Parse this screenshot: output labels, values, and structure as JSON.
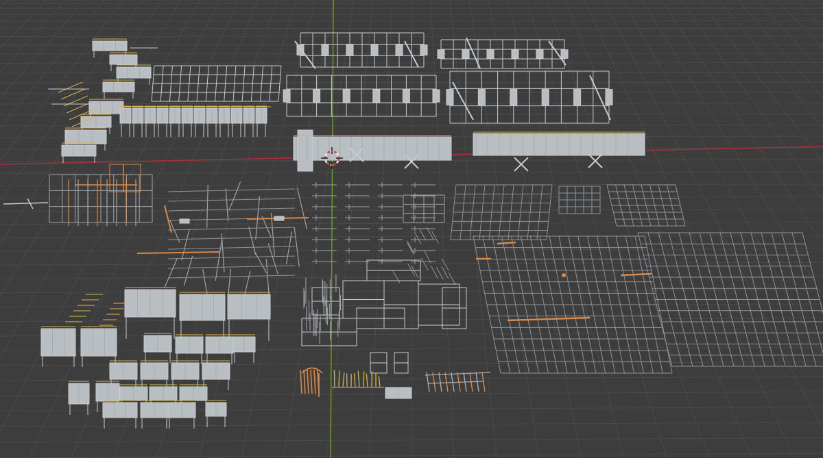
{
  "viewport": {
    "mode": "perspective",
    "colors": {
      "background": "#3d3d3d",
      "grid": "#4a4a4a",
      "x_axis": "#a8303c",
      "y_axis": "#6e9a2a",
      "asset": "#c8ccd0",
      "asset_fill": "#b9bec3",
      "rail": "#d9b24a",
      "pipe": "#d98a4a",
      "cursor_red": "#e04040",
      "cursor_white": "#f0f0f0"
    }
  },
  "collections": [
    {
      "key": "stairs_platforms_top_left",
      "icon": "staircase-icon"
    },
    {
      "key": "railing_frames_top_left",
      "icon": "grid-icon"
    },
    {
      "key": "large_platform_assemblies_top",
      "icon": "platform-icon"
    },
    {
      "key": "pipe_fittings_left",
      "icon": "pipe-icon"
    },
    {
      "key": "pipe_runs_center",
      "icon": "pipe-icon"
    },
    {
      "key": "pipe_racks_center",
      "icon": "rack-icon"
    },
    {
      "key": "grating_grids_right",
      "icon": "grid-icon"
    },
    {
      "key": "platform_modules_bottom_left",
      "icon": "platform-icon"
    },
    {
      "key": "scaffold_frames_bottom_center",
      "icon": "scaffold-icon"
    },
    {
      "key": "small_parts_bottom",
      "icon": "parts-icon"
    }
  ],
  "cursor": {
    "icon": "3d-cursor-icon"
  }
}
